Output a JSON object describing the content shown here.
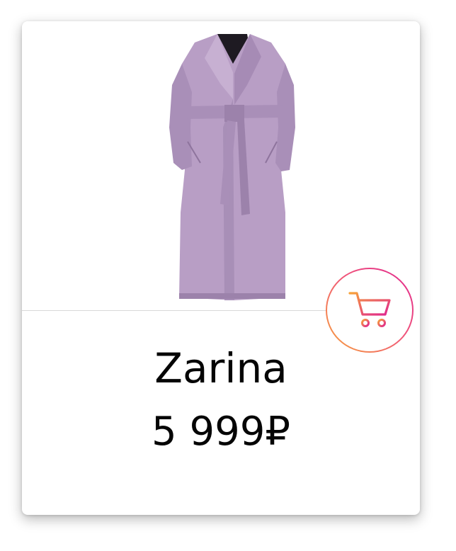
{
  "product": {
    "name": "Zarina",
    "price": "5 999₽",
    "image_icon": "trench-coat-lilac"
  },
  "cart_button": {
    "icon": "cart-icon"
  },
  "colors": {
    "coat": "#b89ec5",
    "coat_shadow": "#9c82ab",
    "gradient_start": "#f7a23a",
    "gradient_end": "#e0258f",
    "text": "#050505"
  }
}
